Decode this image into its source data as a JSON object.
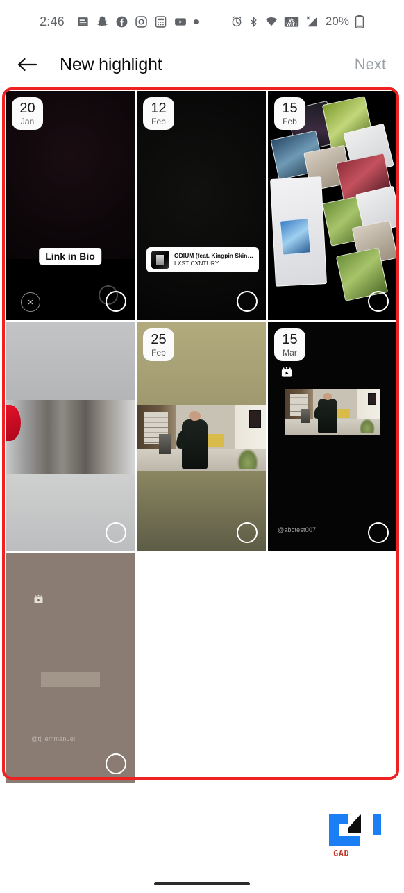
{
  "status_bar": {
    "time": "2:46",
    "battery_text": "20%",
    "notification_icons": [
      "news-icon",
      "snapchat-icon",
      "facebook-icon",
      "instagram-icon",
      "calculator-icon",
      "youtube-icon",
      "more-dot-icon"
    ],
    "system_icons": [
      "alarm-icon",
      "bluetooth-icon",
      "wifi-icon",
      "volte-wifi-icon",
      "no-sim-signal-icon",
      "battery-icon"
    ]
  },
  "app_bar": {
    "back_label": "←",
    "title": "New highlight",
    "next_label": "Next"
  },
  "annotation": {
    "color": "#ee2222",
    "shape": "rounded-rectangle"
  },
  "grid": {
    "columns": 3,
    "items": [
      {
        "id": "story-1",
        "date_day": "20",
        "date_month": "Jan",
        "sticker_type": "link",
        "sticker_text": "Link in Bio",
        "selected": false,
        "has_close_button": true,
        "close_label": "×",
        "background_kind": "dark-maroon"
      },
      {
        "id": "story-2",
        "date_day": "12",
        "date_month": "Feb",
        "sticker_type": "music",
        "music_title": "ODIUM (feat. Kingpin Skinny Pimp)",
        "music_artist": "LXST CXNTURY",
        "selected": false,
        "background_kind": "black"
      },
      {
        "id": "story-3",
        "date_day": "15",
        "date_month": "Feb",
        "sticker_type": "none",
        "selected": false,
        "background_kind": "screenshot-collage"
      },
      {
        "id": "story-4",
        "date_day": "",
        "date_month": "",
        "sticker_type": "none",
        "selected": false,
        "background_kind": "silver-metal"
      },
      {
        "id": "story-5",
        "date_day": "25",
        "date_month": "Feb",
        "sticker_type": "none",
        "selected": false,
        "background_kind": "khaki-corridor-video"
      },
      {
        "id": "story-6",
        "date_day": "15",
        "date_month": "Mar",
        "sticker_type": "none",
        "username": "@abctest007",
        "has_reel_icon": true,
        "selected": false,
        "background_kind": "black-centered-video"
      },
      {
        "id": "story-7",
        "date_day": "",
        "date_month": "",
        "sticker_type": "none",
        "username": "@tj_emmanuel",
        "has_reel_icon": true,
        "selected": false,
        "background_kind": "taupe-night-video"
      }
    ]
  },
  "watermark": {
    "text": "GAD"
  },
  "nav_bar": {
    "type": "gesture-pill"
  }
}
